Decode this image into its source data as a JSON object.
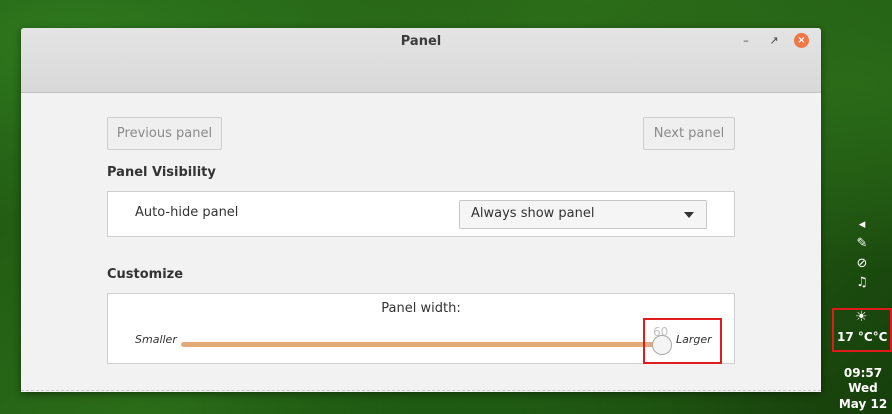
{
  "window": {
    "title": "Panel",
    "controls": {
      "minimize": "–",
      "maximize": "↗",
      "close": "×"
    }
  },
  "nav": {
    "previous_label": "Previous panel",
    "next_label": "Next panel"
  },
  "visibility": {
    "section_title": "Panel Visibility",
    "autohide_label": "Auto-hide panel",
    "autohide_value": "Always show panel"
  },
  "customize": {
    "section_title": "Customize",
    "width_label": "Panel width:",
    "smaller_label": "Smaller",
    "larger_label": "Larger",
    "width_value": "60"
  },
  "tray": {
    "icons": [
      "chevron-left-icon",
      "network-icon",
      "paperclip-icon",
      "music-icon"
    ],
    "weather_icon": "partly-cloudy-icon",
    "temperature": "17 °C°C",
    "time": "09:57",
    "day": "Wed",
    "date": "May 12"
  },
  "colors": {
    "slider_fill": "#e3a978",
    "close_button": "#f07746",
    "highlight": "#e01b1b"
  }
}
